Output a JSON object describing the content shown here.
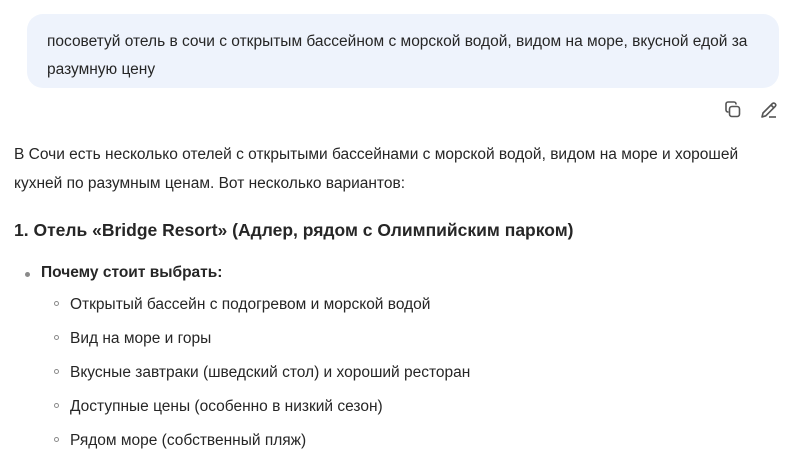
{
  "user_message": "посоветуй отель в сочи с открытым бассейном с морской водой, видом на море, вкусной едой за разумную цену",
  "actions": {
    "copy_icon": "copy-icon",
    "edit_icon": "pencil-icon"
  },
  "answer": {
    "intro": "В Сочи есть несколько отелей с открытыми бассейнами с морской водой, видом на море и хорошей кухней по разумным ценам. Вот несколько вариантов:",
    "hotel_heading": "1. Отель «Bridge Resort» (Адлер, рядом с Олимпийским парком)",
    "why_label": "Почему стоит выбрать:",
    "reasons": [
      "Открытый бассейн с подогревом и морской водой",
      "Вид на море и горы",
      "Вкусные завтраки (шведский стол) и хороший ресторан",
      "Доступные цены (особенно в низкий сезон)",
      "Рядом море (собственный пляж)"
    ]
  }
}
